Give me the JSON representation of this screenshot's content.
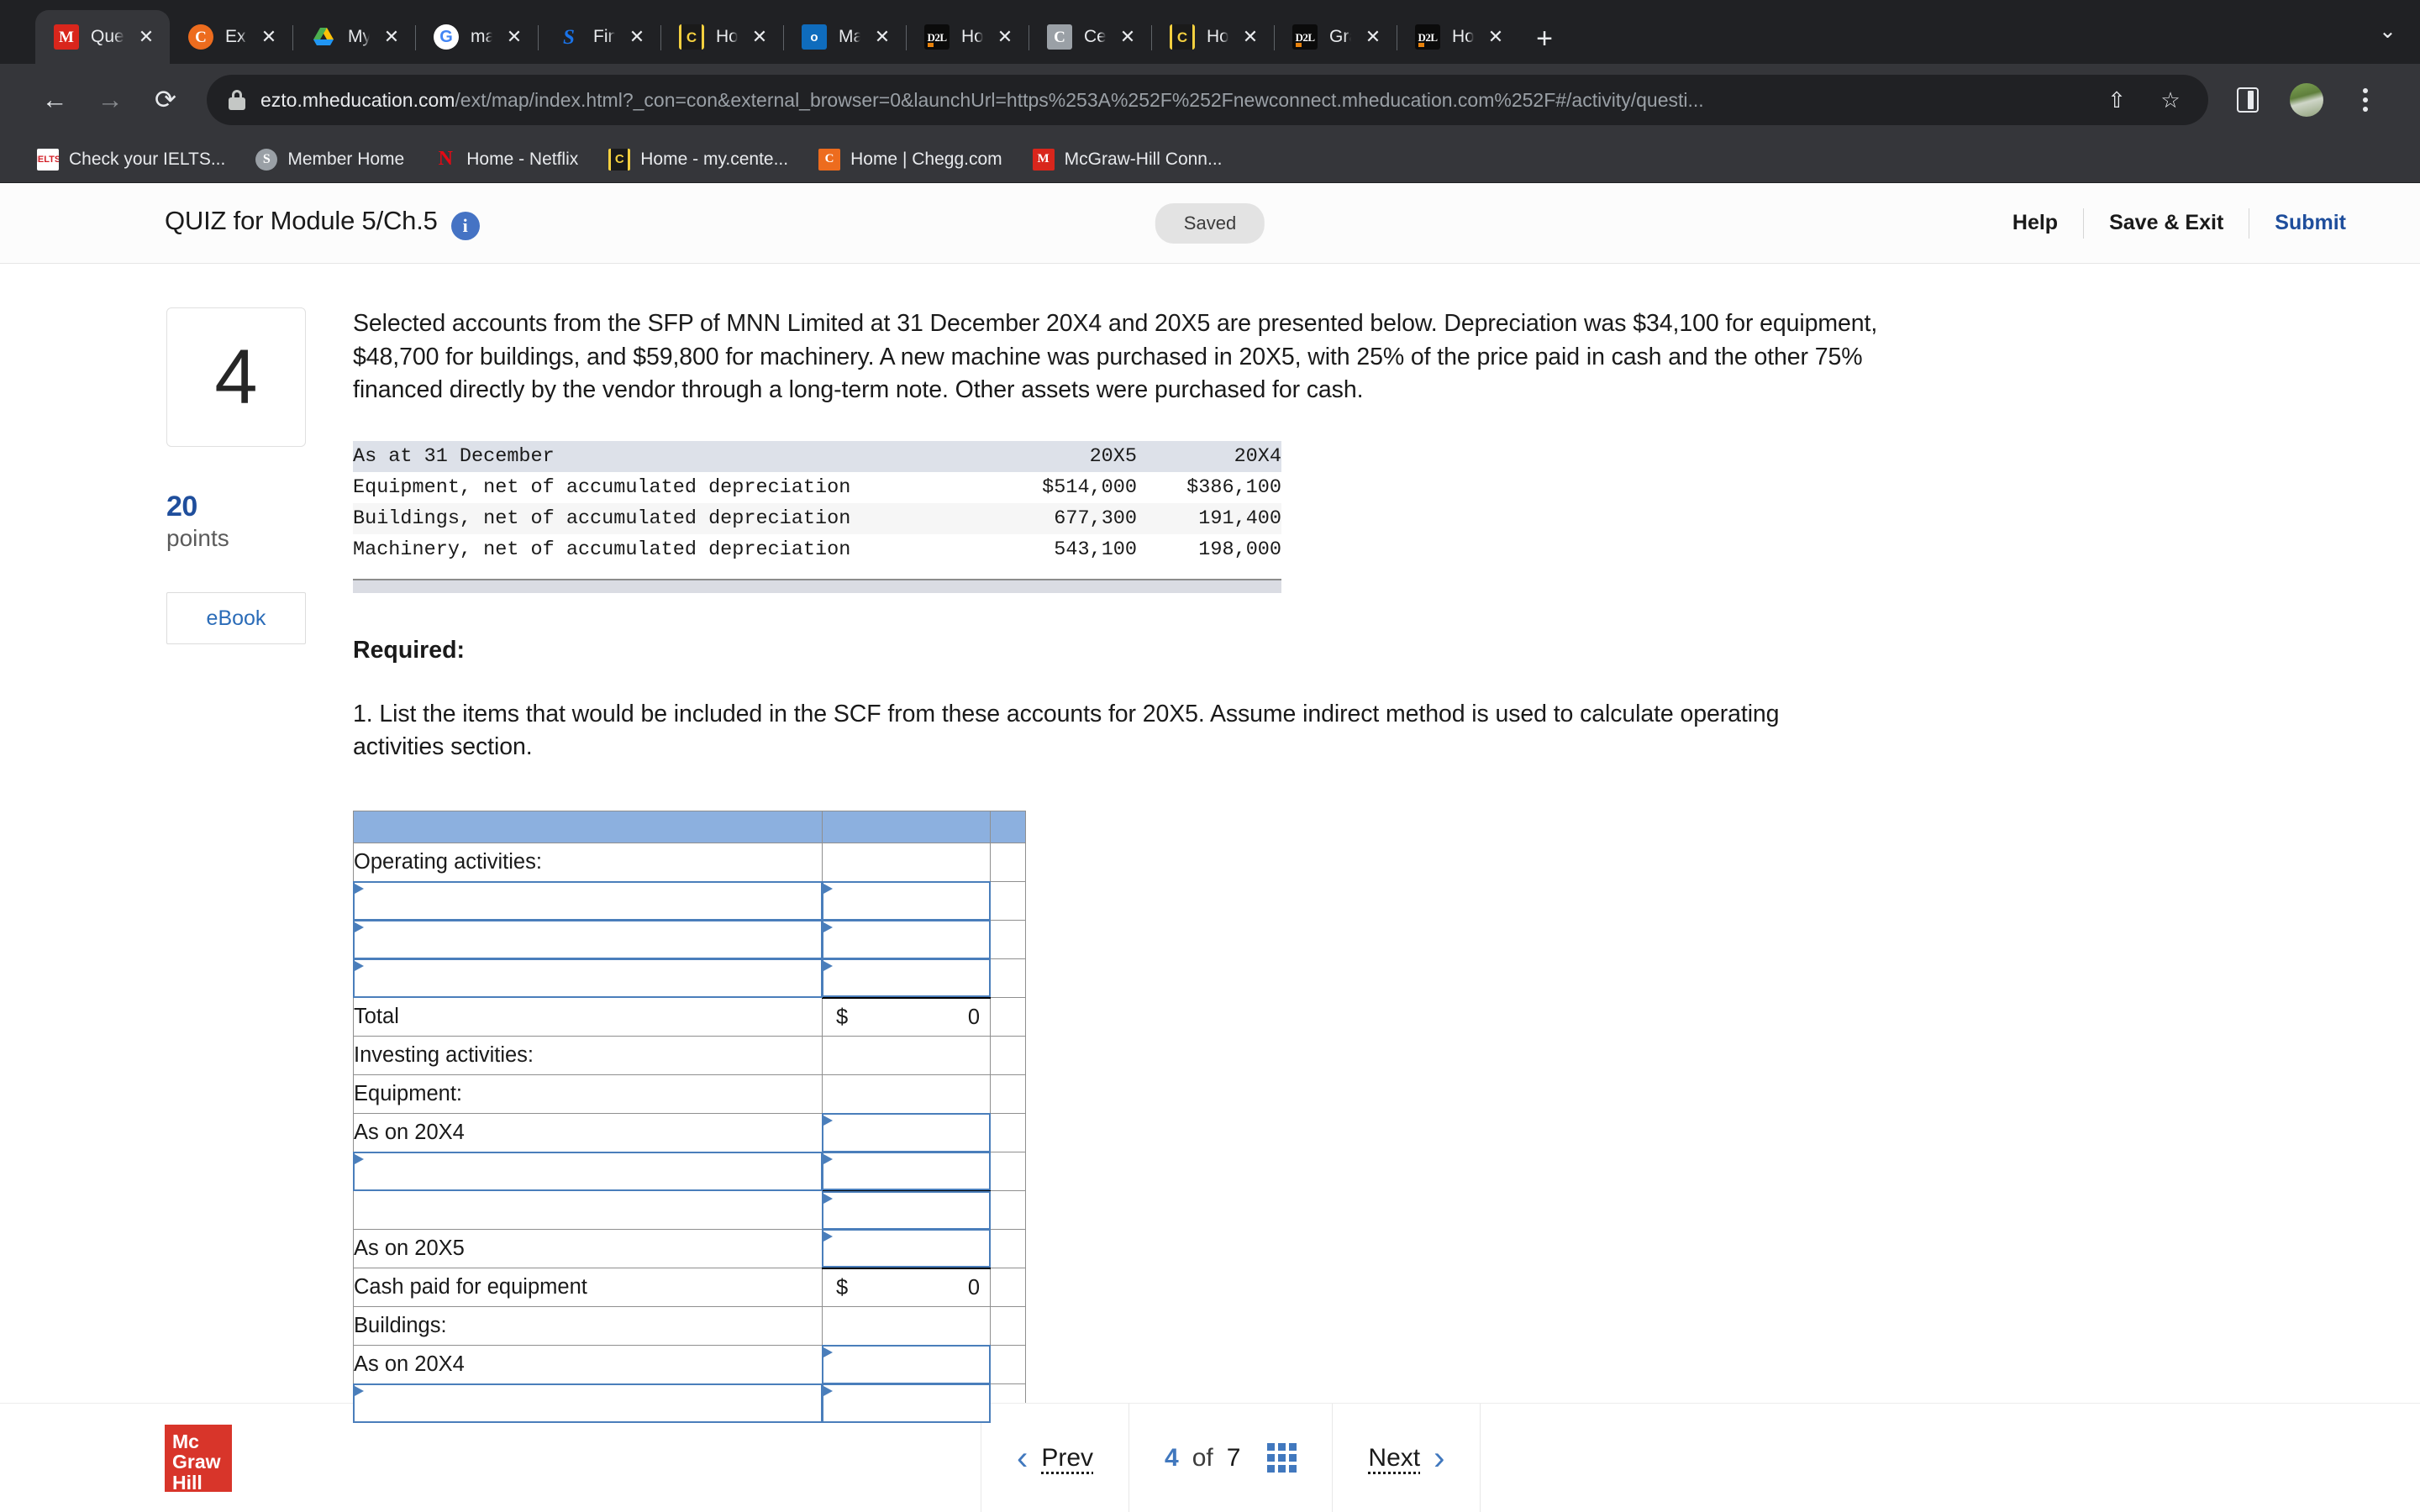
{
  "browser": {
    "tabs": [
      {
        "title": "Question",
        "favicon": "mcgraw-hill-icon",
        "active": true
      },
      {
        "title": "Expert Q",
        "favicon": "chegg-icon",
        "active": false
      },
      {
        "title": "My Drive",
        "favicon": "google-drive-icon",
        "active": false
      },
      {
        "title": "marketa",
        "favicon": "google-icon",
        "active": false
      },
      {
        "title": "Financia",
        "favicon": "scribd-icon",
        "active": false
      },
      {
        "title": "Home -",
        "favicon": "centennial-icon",
        "active": false
      },
      {
        "title": "Mail - E",
        "favicon": "outlook-icon",
        "active": false
      },
      {
        "title": "Homepa",
        "favicon": "d2l-icon",
        "active": false
      },
      {
        "title": "Centenn",
        "favicon": "course-hero-icon",
        "active": false
      },
      {
        "title": "Home -",
        "favicon": "centennial-icon",
        "active": false
      },
      {
        "title": "Grades",
        "favicon": "d2l-icon",
        "active": false
      },
      {
        "title": "Homepa",
        "favicon": "d2l-icon",
        "active": false
      }
    ],
    "new_tab_label": "+",
    "tab_list_chevron": "⌄",
    "nav": {
      "back": "←",
      "forward": "→",
      "reload": "⟳"
    },
    "url_domain": "ezto.mheducation.com",
    "url_path": "/ext/map/index.html?_con=con&external_browser=0&launchUrl=https%253A%252F%252Fnewconnect.mheducation.com%252F#/activity/questi...",
    "omni_share_icon": "share-icon",
    "omni_star_icon": "bookmark-star-icon",
    "side_panel_icon": "side-panel-icon",
    "profile_icon": "avatar",
    "menu_icon": "kebab-menu-icon",
    "bookmarks": [
      {
        "label": "Check your IELTS...",
        "favicon": "ielts-icon"
      },
      {
        "label": "Member Home",
        "favicon": "member-icon"
      },
      {
        "label": "Home - Netflix",
        "favicon": "netflix-icon"
      },
      {
        "label": "Home - my.cente...",
        "favicon": "centennial-icon"
      },
      {
        "label": "Home | Chegg.com",
        "favicon": "chegg-icon"
      },
      {
        "label": "McGraw-Hill Conn...",
        "favicon": "mcgraw-hill-icon"
      }
    ]
  },
  "header": {
    "quiz_title": "QUIZ for Module 5/Ch.5",
    "info_icon_glyph": "i",
    "saved_badge": "Saved",
    "help_label": "Help",
    "save_exit_label": "Save & Exit",
    "submit_label": "Submit",
    "submit_color": "#1f4e9c"
  },
  "question": {
    "number": "4",
    "points_value": "20",
    "points_label": "points",
    "ebook_label": "eBook",
    "prompt": "Selected accounts from the SFP of MNN Limited at 31 December 20X4 and 20X5 are presented below. Depreciation was $34,100 for equipment, $48,700 for buildings, and $59,800 for machinery. A new machine was purchased in 20X5, with 25% of the price paid in cash and the other 75% financed directly by the vendor through a long-term note. Other assets were purchased for cash.",
    "required_heading": "Required:",
    "required_body": "1. List the items that would be included in the SCF from these accounts for 20X5. Assume indirect method is used to calculate operating activities section."
  },
  "exhibit": {
    "header": {
      "label": "As at 31 December",
      "col1": "20X5",
      "col2": "20X4"
    },
    "rows": [
      {
        "label": "Equipment, net of accumulated depreciation",
        "v1": "$514,000",
        "v2": "$386,100"
      },
      {
        "label": "Buildings, net of accumulated depreciation",
        "v1": "677,300",
        "v2": "191,400"
      },
      {
        "label": "Machinery, net of accumulated depreciation",
        "v1": "543,100",
        "v2": "198,000"
      }
    ]
  },
  "answer_grid": {
    "rows": [
      {
        "kind": "bluebar",
        "label": "",
        "value": "",
        "value_kind": "blank"
      },
      {
        "kind": "text",
        "label": "Operating activities:",
        "indent": 1,
        "value": "",
        "value_kind": "blank"
      },
      {
        "kind": "select",
        "label": "",
        "indent": 1,
        "value": "",
        "value_kind": "select"
      },
      {
        "kind": "select",
        "label": "",
        "indent": 1,
        "value": "",
        "value_kind": "select"
      },
      {
        "kind": "select",
        "label": "",
        "indent": 1,
        "value": "",
        "value_kind": "select",
        "value_underline_bottom": true
      },
      {
        "kind": "text",
        "label": "Total",
        "indent": 2,
        "value_kind": "money",
        "currency": "$",
        "amount": "0",
        "value_top_rule": true
      },
      {
        "kind": "text",
        "label": "Investing activities:",
        "indent": 1,
        "value": "",
        "value_kind": "blank"
      },
      {
        "kind": "text",
        "label": "Equipment:",
        "indent": 1,
        "value": "",
        "value_kind": "blank"
      },
      {
        "kind": "text",
        "label": "As on 20X4",
        "indent": 2,
        "value_kind": "select"
      },
      {
        "kind": "select",
        "label": "",
        "indent": 1,
        "value_kind": "select"
      },
      {
        "kind": "text",
        "label": "",
        "indent": 1,
        "value_kind": "select",
        "value_top_rule": true
      },
      {
        "kind": "text",
        "label": "As on 20X5",
        "indent": 2,
        "value_kind": "select"
      },
      {
        "kind": "text",
        "label": "Cash paid for equipment",
        "indent": 3,
        "value_kind": "money",
        "currency": "$",
        "amount": "0",
        "value_top_rule": true
      },
      {
        "kind": "text",
        "label": "Buildings:",
        "indent": 1,
        "value": "",
        "value_kind": "blank"
      },
      {
        "kind": "text",
        "label": "As on 20X4",
        "indent": 2,
        "value_kind": "select"
      },
      {
        "kind": "select",
        "label": "",
        "indent": 1,
        "value_kind": "select"
      }
    ]
  },
  "footer": {
    "logo_line1": "Mc",
    "logo_line2": "Graw",
    "logo_line3": "Hill",
    "prev_label": "Prev",
    "prev_chevron": "‹",
    "current_page": "4",
    "of_label": "of",
    "total_pages": "7",
    "grid_icon": "grid-view-icon",
    "next_label": "Next",
    "next_chevron": "›"
  },
  "colors": {
    "accent_blue": "#4178be",
    "submit_blue": "#1f4e9c",
    "field_border": "#4a7ebb",
    "bluebar": "#8cb0df",
    "brand_red": "#d8352a"
  }
}
